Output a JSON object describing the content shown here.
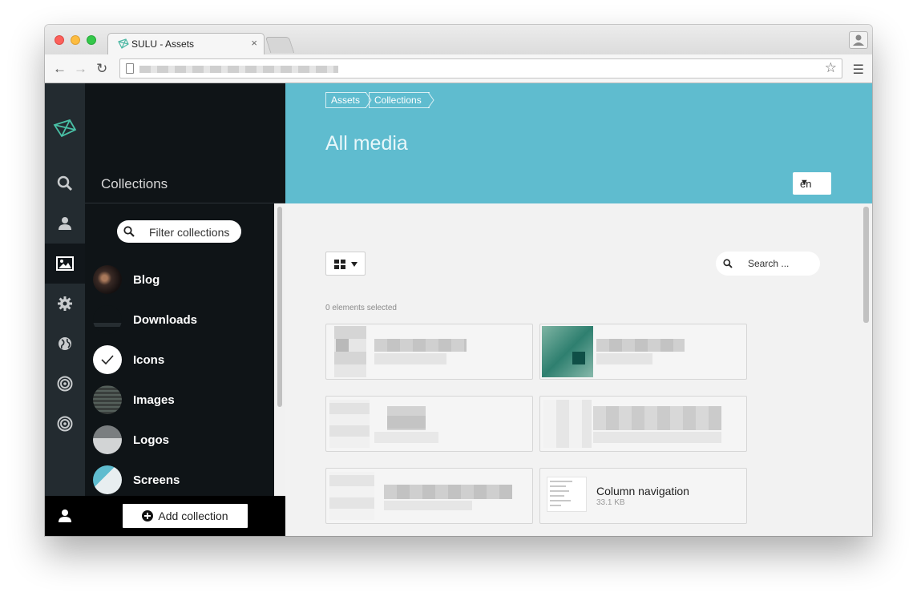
{
  "browser": {
    "tab_title": "SULU - Assets",
    "tab_close": "×"
  },
  "sidebar_nav": {
    "items": [
      "search",
      "user",
      "media",
      "settings",
      "globe",
      "target",
      "target"
    ],
    "active": "media"
  },
  "collections": {
    "title": "Collections",
    "filter_label": "Filter collections",
    "items": [
      {
        "label": "Blog"
      },
      {
        "label": "Downloads"
      },
      {
        "label": "Icons"
      },
      {
        "label": "Images"
      },
      {
        "label": "Logos"
      },
      {
        "label": "Screens"
      }
    ],
    "add_label": "Add collection"
  },
  "header": {
    "breadcrumb": [
      "Assets",
      "Collections"
    ],
    "title": "All media",
    "language": "en"
  },
  "toolbar": {
    "search_placeholder": "Search ...",
    "selected_text": "0 elements selected"
  },
  "media": {
    "visible_item": {
      "title": "Column navigation",
      "size": "33.1 KB"
    }
  },
  "colors": {
    "accent": "#5fbccf",
    "navbar": "#232b30",
    "collections_bg": "#0f1417"
  }
}
